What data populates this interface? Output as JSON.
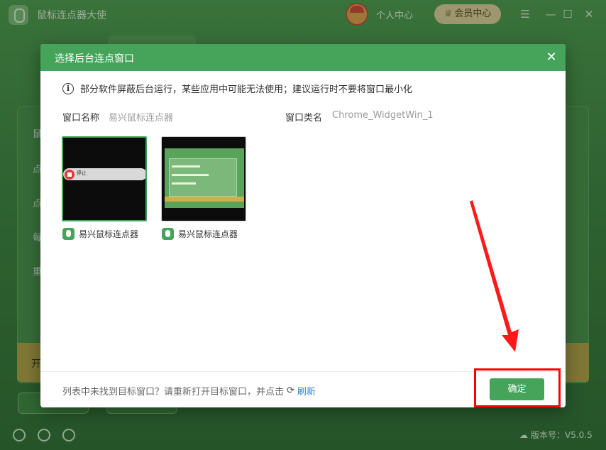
{
  "app": {
    "title": "鼠标连点器大使",
    "user_center": "个人中心",
    "vip_center": "会员中心",
    "version": "版本号：V5.0.5",
    "start_partial": "开",
    "side_labels": [
      "鼠",
      "点",
      "点",
      "每",
      "重"
    ]
  },
  "dialog": {
    "title": "选择后台连点窗口",
    "notice": "部分软件屏蔽后台运行，某些应用中可能无法使用；建议运行时不要将窗口最小化",
    "window_name_label": "窗口名称",
    "window_name_value": "易兴鼠标连点器",
    "window_class_label": "窗口类名",
    "window_class_value": "Chrome_WidgetWin_1",
    "windows": [
      {
        "label": "易兴鼠标连点器",
        "preview_text": "停止"
      },
      {
        "label": "易兴鼠标连点器"
      }
    ],
    "footer_hint": "列表中未找到目标窗口？请重新打开目标窗口，并点击",
    "refresh_label": "刷新",
    "confirm_label": "确定"
  },
  "colors": {
    "accent": "#45a35a",
    "link": "#2e7ddb",
    "annotation": "#ff0000"
  }
}
